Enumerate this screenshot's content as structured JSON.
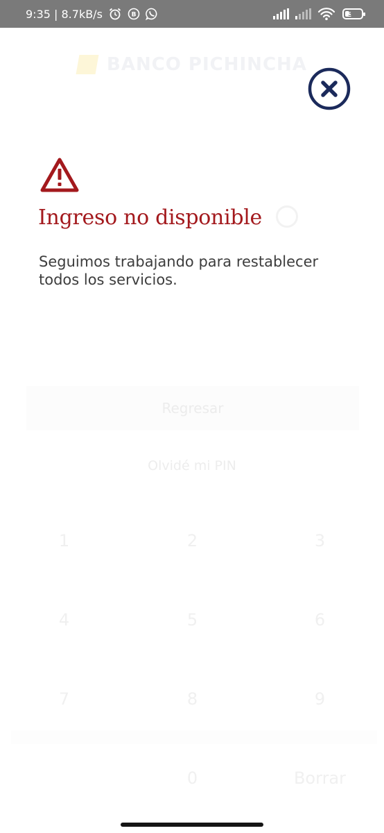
{
  "status_bar": {
    "time_speed": "9:35 | 8.7kB/s",
    "battery_percent": "36",
    "icons": [
      "alarm-icon",
      "b-badge-icon",
      "whatsapp-icon",
      "signal-icon",
      "signal-weak-icon",
      "wifi-icon",
      "battery-icon"
    ]
  },
  "background_app": {
    "brand": "BANCO PICHINCHA",
    "return_button": "Regresar",
    "forgot_pin": "Olvidé mi PIN",
    "keypad": [
      "1",
      "2",
      "3",
      "4",
      "5",
      "6",
      "7",
      "8",
      "9",
      "0",
      "Borrar"
    ]
  },
  "modal": {
    "title": "Ingreso no disponible",
    "message": "Seguimos trabajando para restablecer todos los servicios.",
    "colors": {
      "title": "#a3191d",
      "close": "#1b2a5b",
      "warning": "#a3191d"
    }
  }
}
